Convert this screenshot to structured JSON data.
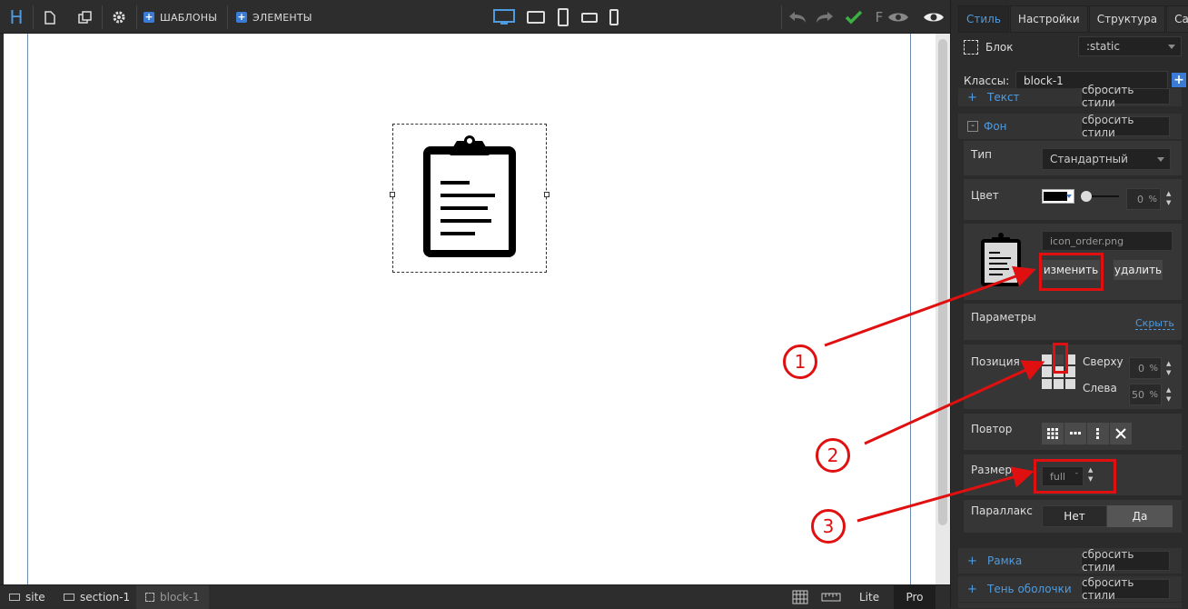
{
  "toolbar": {
    "templates_label": "ШАБЛОНЫ",
    "elements_label": "ЭЛЕМЕНТЫ",
    "logo": "H",
    "font_letter": "F"
  },
  "statusbar": {
    "crumbs": [
      "site",
      "section-1",
      "block-1"
    ],
    "lite_label": "Lite",
    "pro_label": "Pro"
  },
  "panel": {
    "tabs": [
      "Стиль",
      "Настройки",
      "Структура",
      "Сайт"
    ],
    "block_label": "Блок",
    "position_value": ":static",
    "classes_label": "Классы:",
    "class_value": "block-1",
    "reset_label": "сбросить стили",
    "sections": {
      "text": "Текст",
      "background": "Фон",
      "border": "Рамка",
      "shadow": "Тень оболочки"
    },
    "bg": {
      "type_label": "Тип",
      "type_value": "Стандартный",
      "color_label": "Цвет",
      "color_value": "#000000",
      "opacity": "0",
      "pct": "%",
      "filename": "icon_order.png",
      "change_label": "изменить",
      "delete_label": "удалить",
      "params_label": "Параметры",
      "hide_label": "Скрыть",
      "position_label": "Позиция",
      "top_label": "Сверху",
      "top_value": "0",
      "left_label": "Слева",
      "left_value": "50",
      "repeat_label": "Повтор",
      "size_label": "Размер",
      "size_value": "full",
      "parallax_label": "Параллакс",
      "parallax_no": "Нет",
      "parallax_yes": "Да"
    }
  },
  "annotations": [
    "1",
    "2",
    "3"
  ],
  "colors": {
    "accent": "#4e9be0",
    "annotation": "#e01010",
    "ok_check": "#3cb043"
  }
}
